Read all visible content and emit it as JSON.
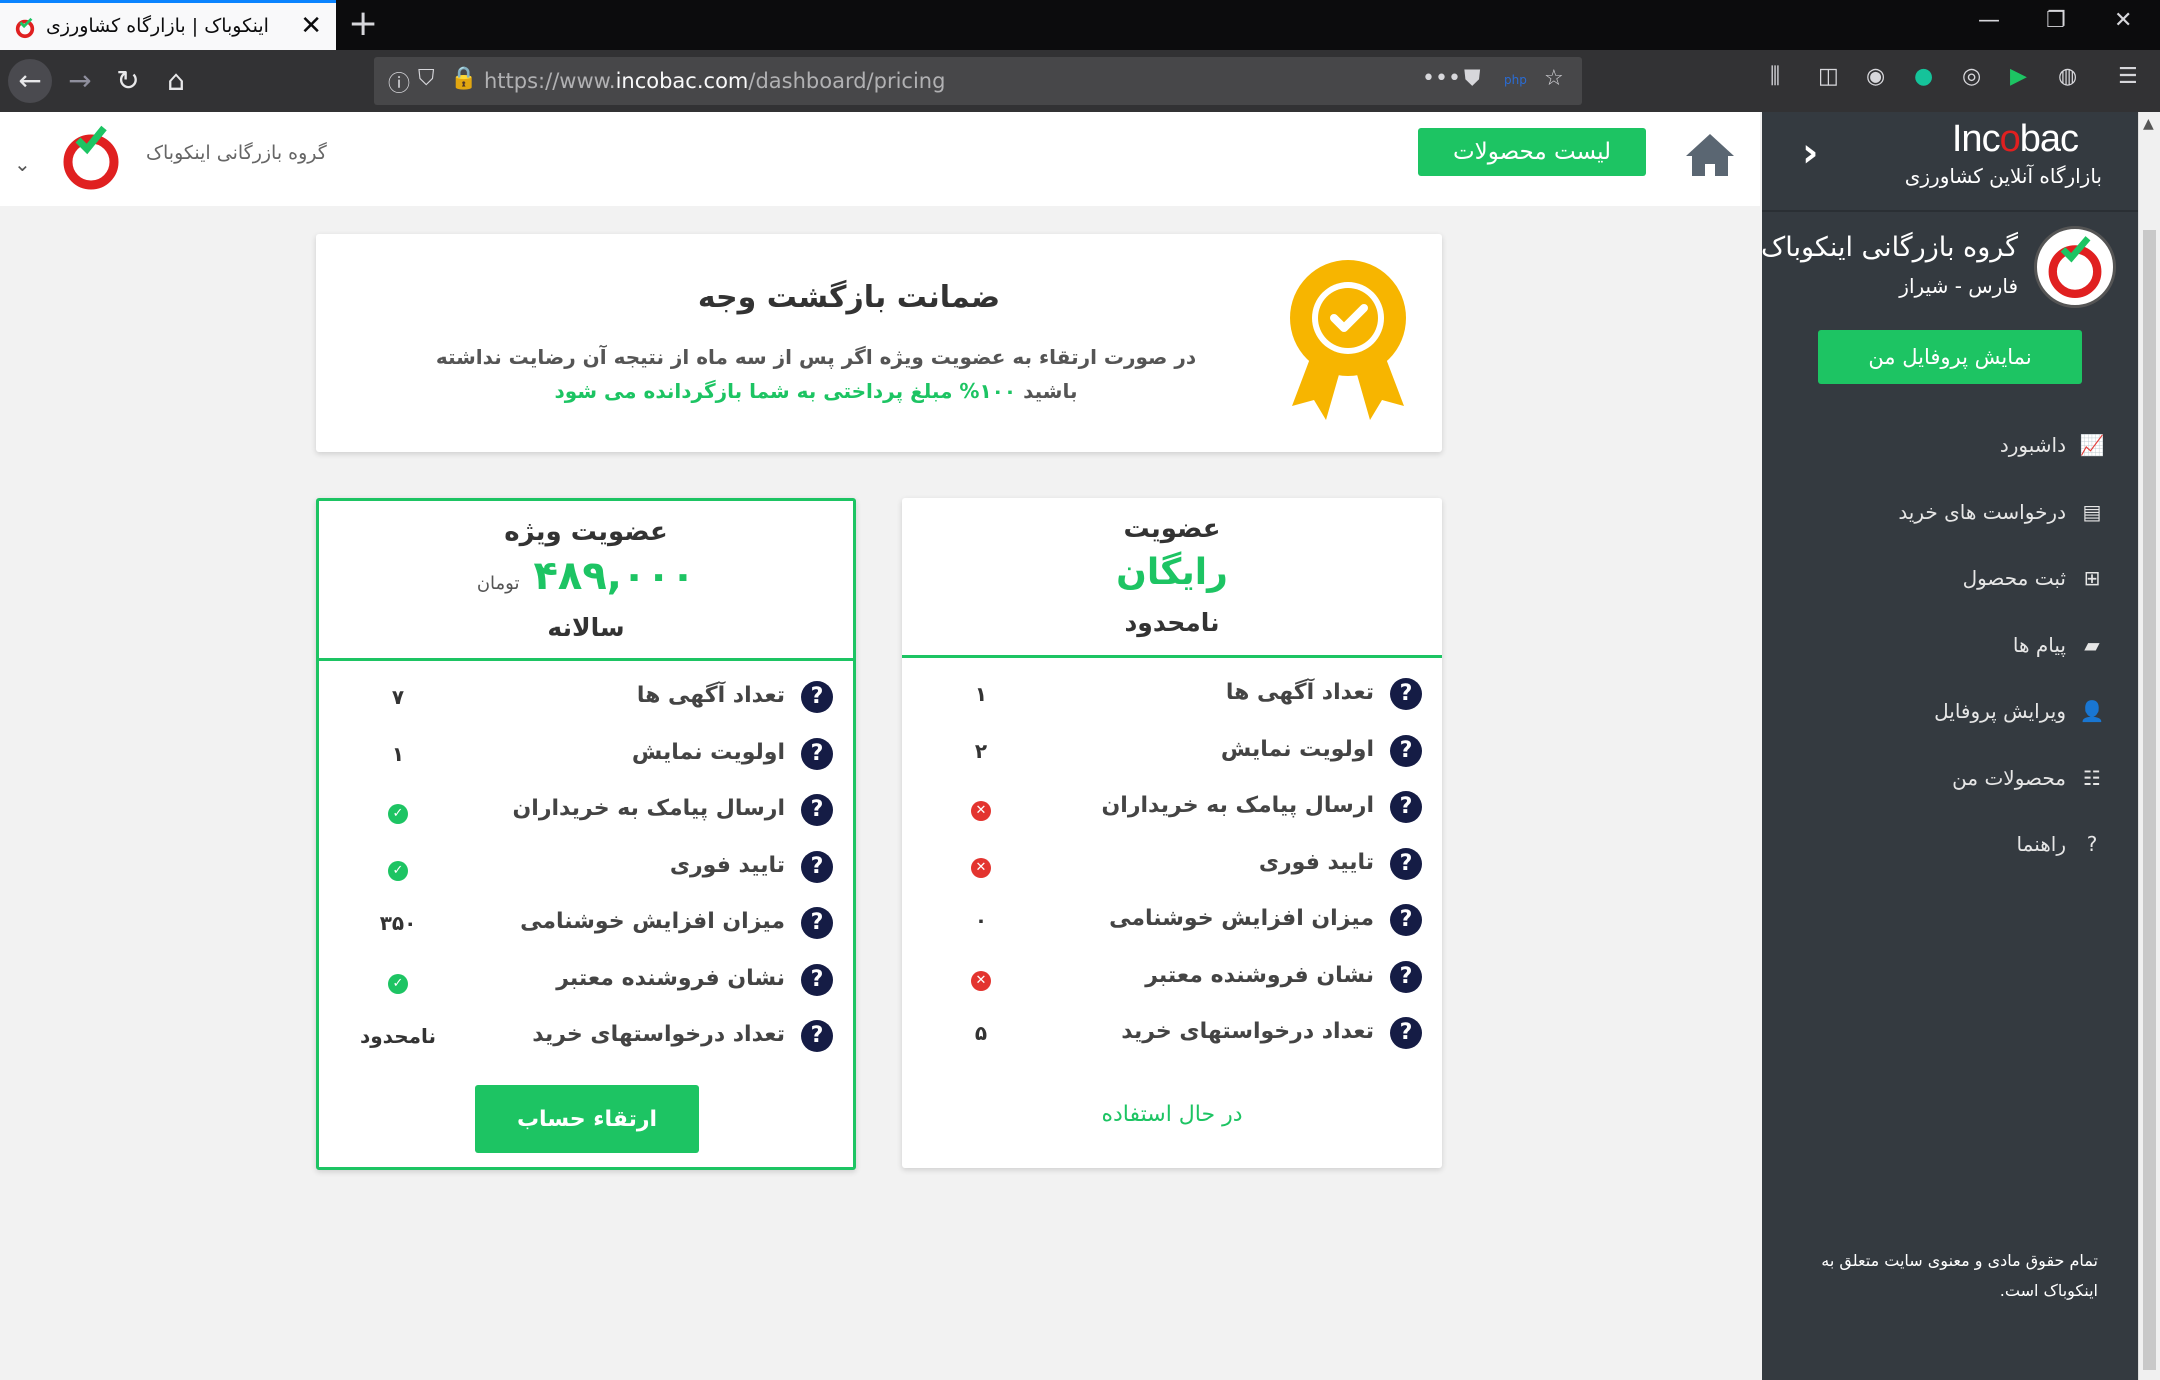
{
  "browser": {
    "tab_title": "اینکوباک | بازارگاه کشاورزی",
    "url_prefix": "https://www.",
    "url_domain": "incobac.com",
    "url_path": "/dashboard/pricing"
  },
  "sidebar": {
    "brand_prefix": "Inc",
    "brand_o": "o",
    "brand_suffix": "bac",
    "tagline": "بازارگاه آنلاین کشاورزی",
    "profile_name": "گروه بازرگانی اینکوباک",
    "profile_location": "فارس - شیراز",
    "profile_button": "نمایش پروفایل من",
    "menu": [
      {
        "label": "داشبورد",
        "icon": "chart-icon"
      },
      {
        "label": "درخواست های خرید",
        "icon": "list-alt-icon"
      },
      {
        "label": "ثبت محصول",
        "icon": "plus-square-icon"
      },
      {
        "label": "پیام ها",
        "icon": "comment-icon"
      },
      {
        "label": "ویرایش پروفایل",
        "icon": "user-icon"
      },
      {
        "label": "محصولات من",
        "icon": "list-icon"
      },
      {
        "label": "راهنما",
        "icon": "question-icon"
      }
    ],
    "copyright": "تمام حقوق مادی و معنوی سایت متعلق به اینکوباک است."
  },
  "header": {
    "products_button": "لیست محصولات",
    "user_name": "گروه بازرگانی اینکوباک"
  },
  "guarantee": {
    "title": "ضمانت بازگشت وجه",
    "text_normal": "در صورت ارتقاء به عضویت ویژه اگر پس از سه ماه از نتیجه آن رضایت نداشته باشید",
    "text_highlight": "۱۰۰% مبلغ پرداختی به شما بازگردانده می شود"
  },
  "premium": {
    "title": "عضویت ویژه",
    "price": "۴۸۹,۰۰۰",
    "currency": "تومان",
    "period": "سالانه",
    "upgrade_button": "ارتقاء حساب",
    "features": [
      {
        "label": "تعداد آگهی ها",
        "value": "۷"
      },
      {
        "label": "اولویت نمایش",
        "value": "۱"
      },
      {
        "label": "ارسال پیامک به خریداران",
        "value": "check"
      },
      {
        "label": "تایید فوری",
        "value": "check"
      },
      {
        "label": "میزان افزایش خوشنامی",
        "value": "۳۵۰"
      },
      {
        "label": "نشان فروشنده معتبر",
        "value": "check"
      },
      {
        "label": "تعداد درخواستهای خرید",
        "value": "نامحدود"
      }
    ]
  },
  "free": {
    "title": "عضویت",
    "price": "رایگان",
    "period": "نامحدود",
    "status": "در حال استفاده",
    "features": [
      {
        "label": "تعداد آگهی ها",
        "value": "۱"
      },
      {
        "label": "اولویت نمایش",
        "value": "۲"
      },
      {
        "label": "ارسال پیامک به خریداران",
        "value": "cross"
      },
      {
        "label": "تایید فوری",
        "value": "cross"
      },
      {
        "label": "میزان افزایش خوشنامی",
        "value": "۰"
      },
      {
        "label": "نشان فروشنده معتبر",
        "value": "cross"
      },
      {
        "label": "تعداد درخواستهای خرید",
        "value": "۵"
      }
    ]
  },
  "colors": {
    "accent_green": "#1dc463",
    "sidebar_bg": "#343a40",
    "question_badge": "#151c45",
    "error_red": "#e3342f"
  }
}
